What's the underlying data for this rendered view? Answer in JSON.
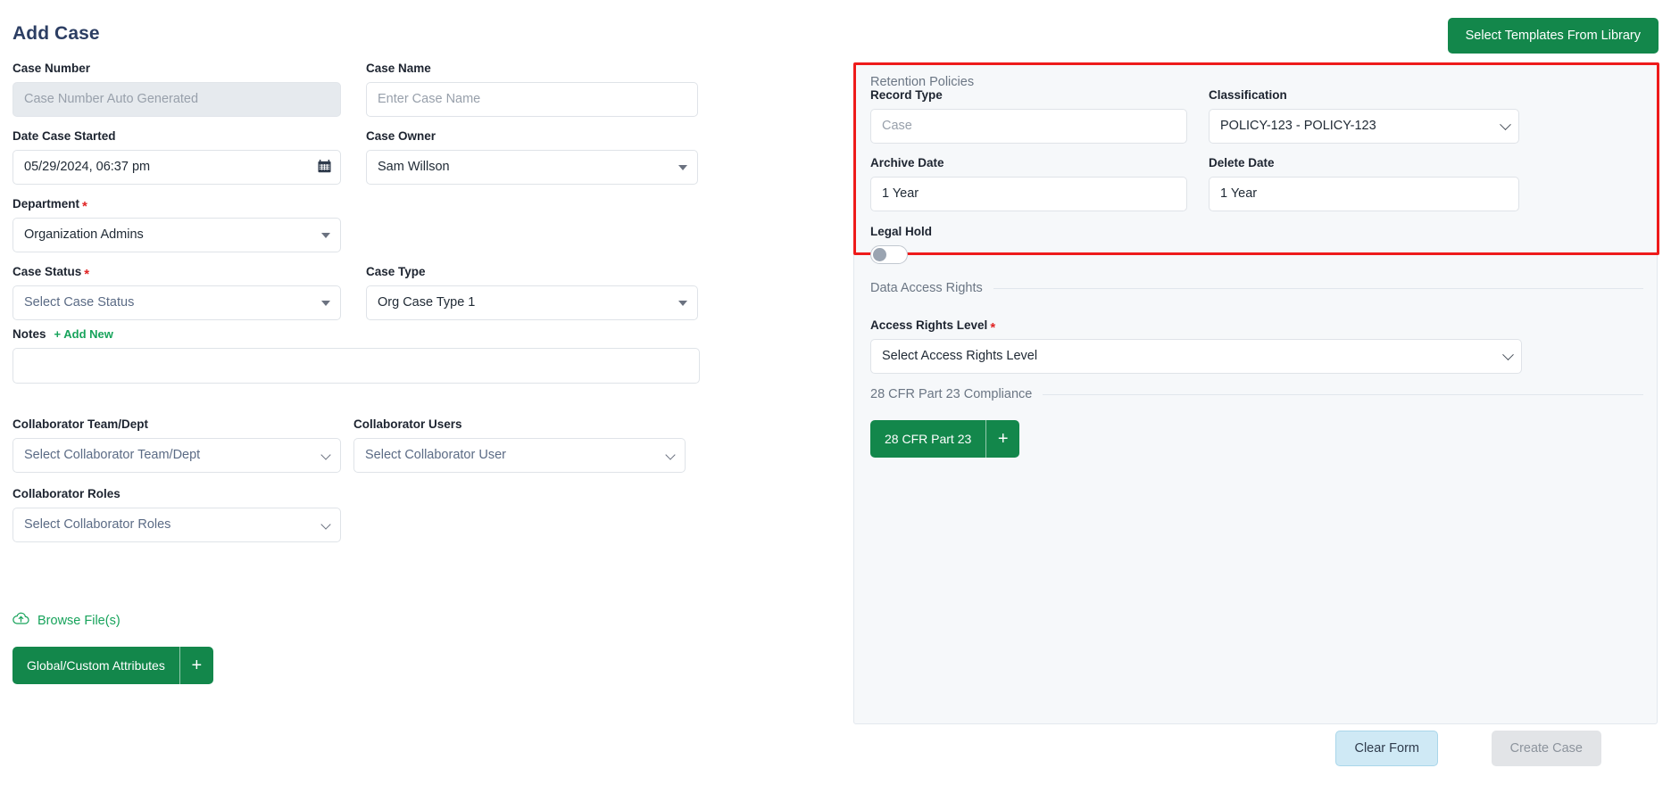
{
  "header": {
    "title": "Add Case",
    "templates_button": "Select Templates From Library"
  },
  "form": {
    "case_number": {
      "label": "Case Number",
      "placeholder": "Case Number Auto Generated",
      "value": ""
    },
    "case_name": {
      "label": "Case Name",
      "placeholder": "Enter Case Name",
      "value": ""
    },
    "date_case_started": {
      "label": "Date Case Started",
      "value": "05/29/2024, 06:37 pm",
      "icon": "calendar-icon"
    },
    "case_owner": {
      "label": "Case Owner",
      "value": "Sam Willson"
    },
    "department": {
      "label": "Department",
      "required": "*",
      "value": "Organization Admins"
    },
    "case_status": {
      "label": "Case Status",
      "required": "*",
      "placeholder": "Select Case Status"
    },
    "case_type": {
      "label": "Case Type",
      "value": "Org Case Type 1"
    },
    "notes": {
      "label": "Notes",
      "add_new": "+ Add New",
      "value": ""
    },
    "collaborator_team": {
      "label": "Collaborator Team/Dept",
      "placeholder": "Select Collaborator Team/Dept"
    },
    "collaborator_users": {
      "label": "Collaborator Users",
      "placeholder": "Select Collaborator User"
    },
    "collaborator_roles": {
      "label": "Collaborator Roles",
      "placeholder": "Select Collaborator Roles"
    },
    "browse_files": {
      "label": "Browse File(s)",
      "icon": "cloud-upload-icon"
    },
    "global_attributes": {
      "label": "Global/Custom Attributes",
      "plus": "+"
    }
  },
  "retention": {
    "section_title": "Retention Policies",
    "record_type": {
      "label": "Record Type",
      "placeholder": "Case",
      "value": ""
    },
    "classification": {
      "label": "Classification",
      "value": "POLICY-123 - POLICY-123"
    },
    "archive_date": {
      "label": "Archive Date",
      "value": "1 Year"
    },
    "delete_date": {
      "label": "Delete Date",
      "value": "1 Year"
    },
    "highlight_color": "#ee1b1b"
  },
  "legal_hold": {
    "label": "Legal Hold",
    "state": "off"
  },
  "data_access": {
    "section_title": "Data Access Rights",
    "access_rights_level": {
      "label": "Access Rights Level",
      "required": "*",
      "placeholder": "Select Access Rights Level"
    }
  },
  "cfr": {
    "section_title": "28 CFR Part 23 Compliance",
    "button": {
      "label": "28 CFR Part 23",
      "plus": "+"
    }
  },
  "footer": {
    "clear_form": "Clear Form",
    "create_case": "Create Case"
  },
  "colors": {
    "brand_green": "#13874b",
    "link_green": "#17a35b",
    "title_navy": "#2c3e63",
    "highlight_red": "#ee1b1b",
    "clear_blue": "#cfe9f5",
    "panel_bg": "#f6f8fa"
  }
}
